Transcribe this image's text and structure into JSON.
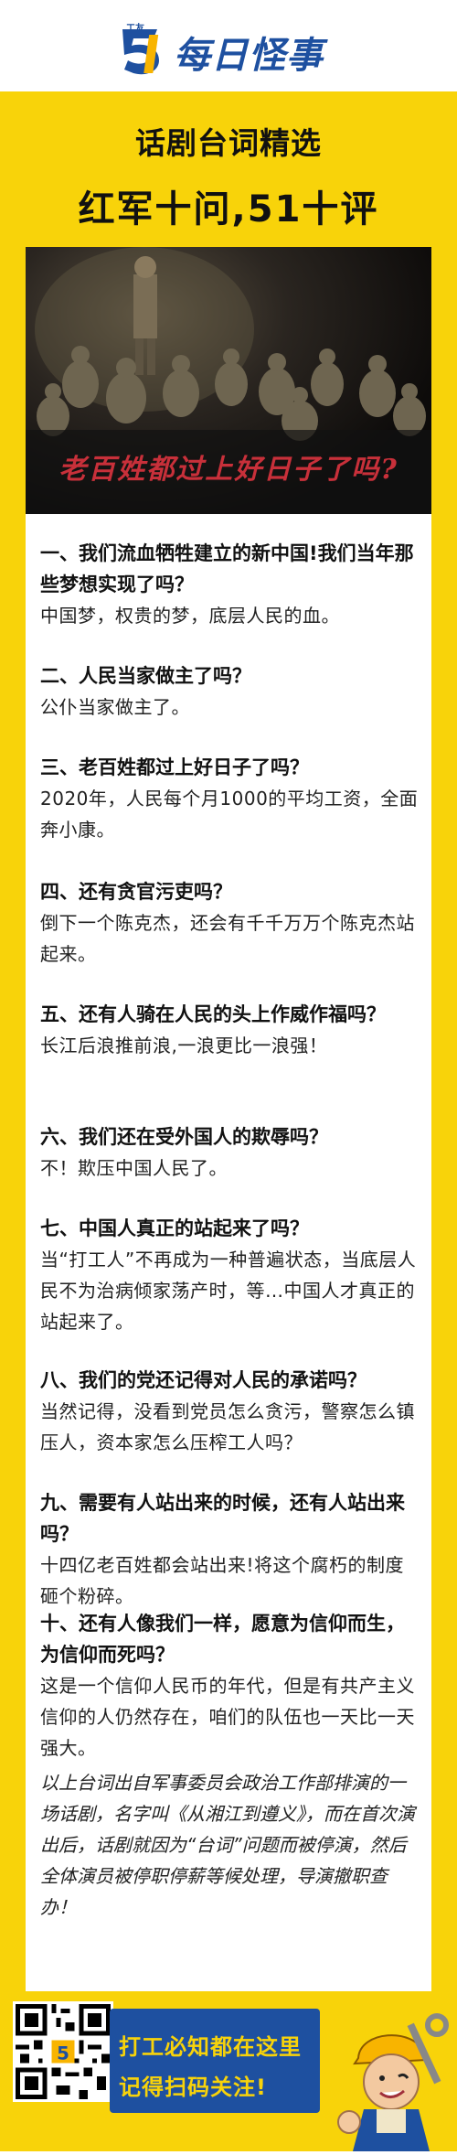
{
  "header": {
    "logo_tag": "工友",
    "logo_text": "每日怪事"
  },
  "titles": {
    "line1": "话剧台词精选",
    "line2": "红军十问,51十评"
  },
  "photo": {
    "caption": "老百姓都过上好日子了吗?"
  },
  "qa": [
    {
      "q": "一、我们流血牺牲建立的新中国!我们当年那些梦想实现了吗？",
      "a": "中国梦，权贵的梦，底层人民的血。"
    },
    {
      "q": "二、人民当家做主了吗？",
      "a": "公仆当家做主了。"
    },
    {
      "q": "三、老百姓都过上好日子了吗？",
      "a": "2020年，人民每个月1000的平均工资，全面奔小康。"
    },
    {
      "q": "四、还有贪官污吏吗？",
      "a": "倒下一个陈克杰，还会有千千万万个陈克杰站起来。"
    },
    {
      "q": "五、还有人骑在人民的头上作威作福吗？",
      "a": "长江后浪推前浪,一浪更比一浪强！"
    },
    {
      "q": "六、我们还在受外国人的欺辱吗？",
      "a": "不！欺压中国人民了。"
    },
    {
      "q": "七、中国人真正的站起来了吗？",
      "a": "当“打工人”不再成为一种普遍状态，当底层人民不为治病倾家荡产时，等…中国人才真正的站起来了。"
    },
    {
      "q": "八、我们的党还记得对人民的承诺吗？",
      "a": "当然记得，没看到党员怎么贪污，警察怎么镇压人，资本家怎么压榨工人吗？"
    },
    {
      "q": "九、需要有人站出来的时候，还有人站出来吗？",
      "a": "十四亿老百姓都会站出来!将这个腐朽的制度砸个粉碎。"
    },
    {
      "q": "十、还有人像我们一样，愿意为信仰而生，为信仰而死吗？",
      "a": "这是一个信仰人民币的年代，但是有共产主义信仰的人仍然存在，咱们的队伍也一天比一天强大。"
    }
  ],
  "note": "以上台词出自军事委员会政治工作部排演的一场话剧，名字叫《从湘江到遵义》，而在首次演出后，话剧就因为“台词”问题而被停演，然后全体演员被停职停薪等候处理，导演撤职查办！",
  "footer": {
    "slogan_line1": "打工必知都在这里",
    "slogan_line2": "记得扫码关注!"
  },
  "colors": {
    "frame": "#f8d30a",
    "brand_blue": "#1e50a0",
    "caption_red": "#c8303a"
  }
}
